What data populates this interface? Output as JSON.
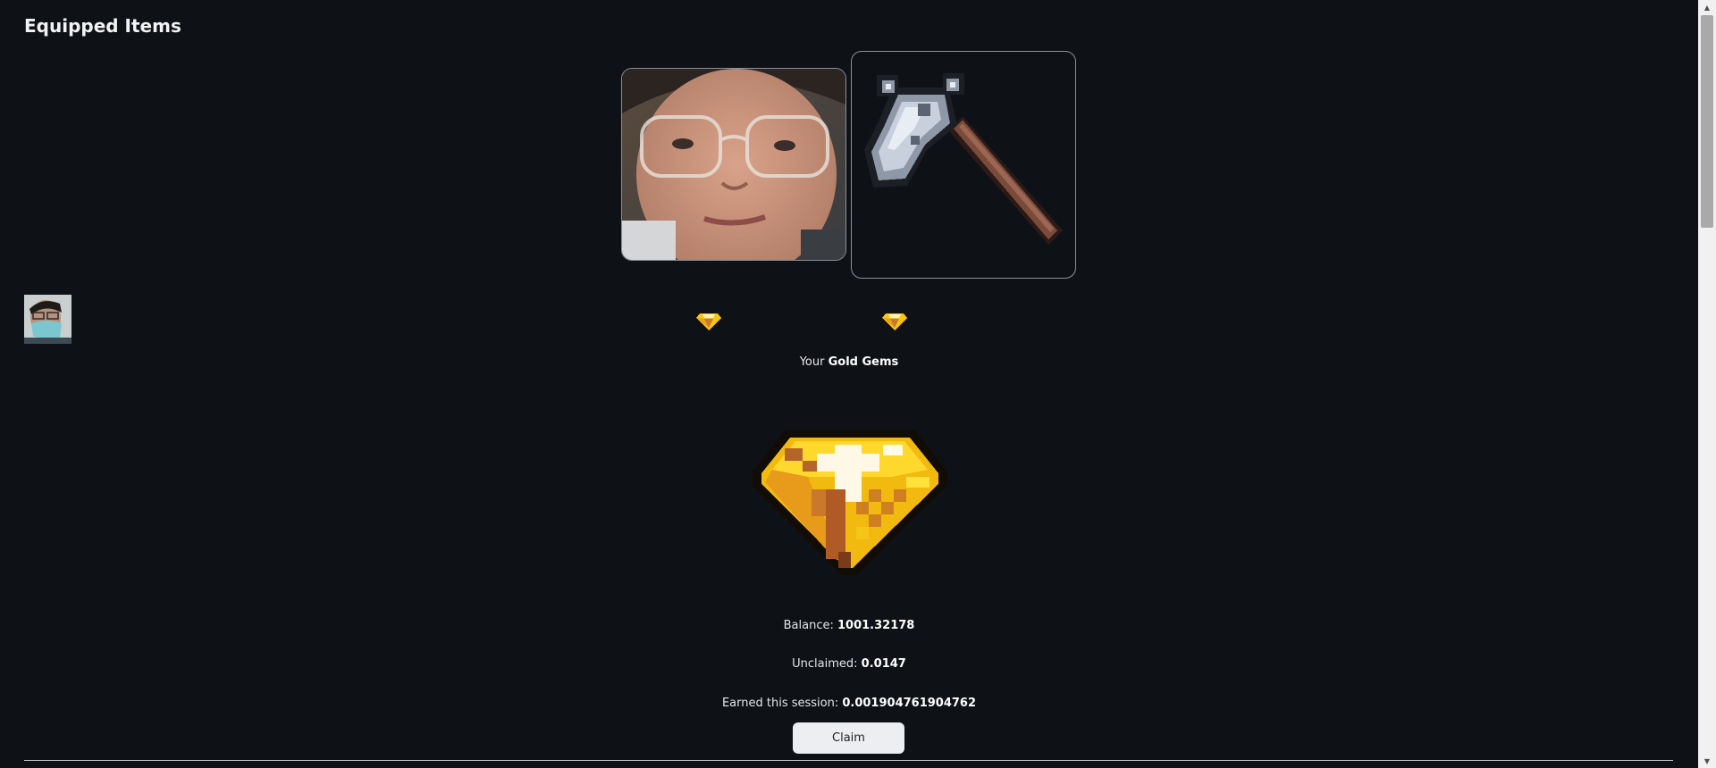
{
  "page": {
    "title": "Equipped Items"
  },
  "gems": {
    "prefix": "Your ",
    "name": "Gold Gems"
  },
  "stats": {
    "balance_label": "Balance: ",
    "balance_value": "1001.32178",
    "unclaimed_label": "Unclaimed: ",
    "unclaimed_value": "0.0147",
    "earned_label": "Earned this session: ",
    "earned_value": "0.001904761904762"
  },
  "actions": {
    "claim_label": "Claim"
  },
  "icons": {
    "equipped_head": "face-photo-icon",
    "equipped_tool": "pixel-axe-icon",
    "small_gem": "gold-gem-icon",
    "big_gem": "gold-gem-icon",
    "avatar": "user-avatar"
  },
  "colors": {
    "background": "#0e1116",
    "gem_gold": "#f5c518",
    "gem_brown": "#b8642a",
    "button_bg": "#eceef1"
  }
}
